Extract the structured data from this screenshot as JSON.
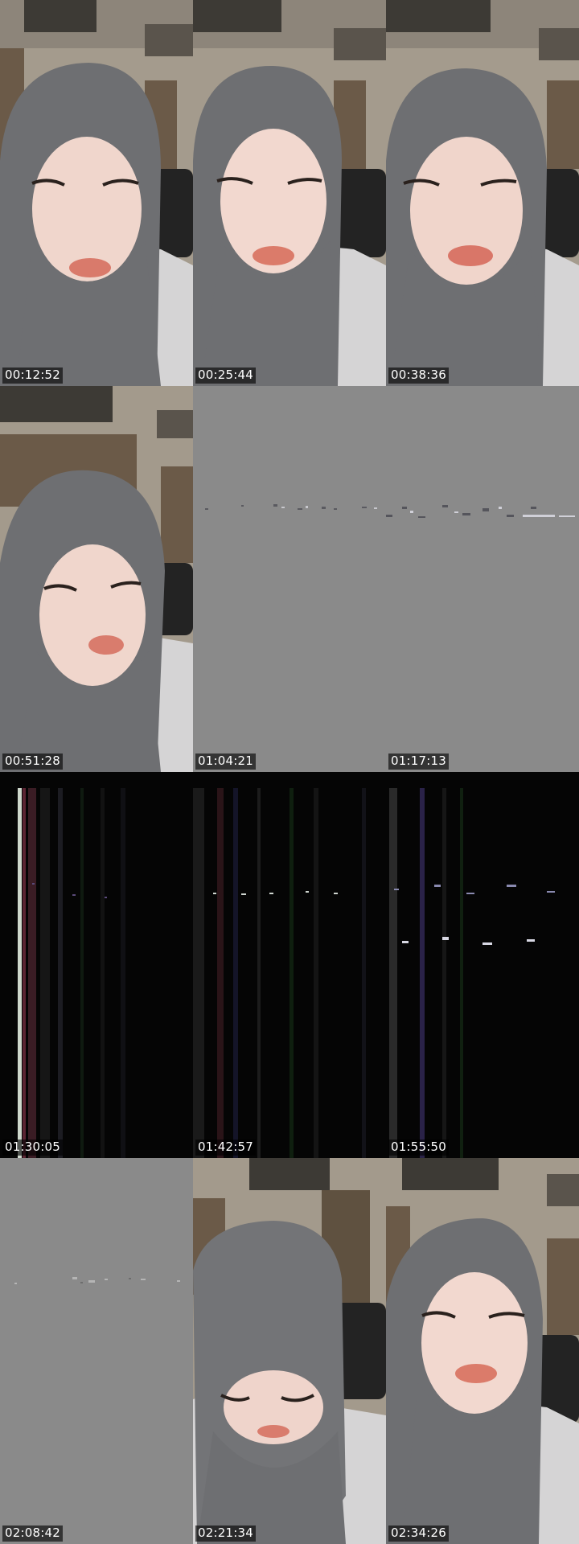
{
  "frames": [
    {
      "timestamp": "00:12:52",
      "kind": "portrait"
    },
    {
      "timestamp": "00:25:44",
      "kind": "portrait"
    },
    {
      "timestamp": "00:38:36",
      "kind": "portrait"
    },
    {
      "timestamp": "00:51:28",
      "kind": "portrait"
    },
    {
      "timestamp": "01:04:21",
      "kind": "gray-glitch"
    },
    {
      "timestamp": "01:17:13",
      "kind": "gray-glitch"
    },
    {
      "timestamp": "01:30:05",
      "kind": "dark-glitch"
    },
    {
      "timestamp": "01:42:57",
      "kind": "dark-glitch"
    },
    {
      "timestamp": "01:55:50",
      "kind": "dark-glitch"
    },
    {
      "timestamp": "02:08:42",
      "kind": "gray-glitch"
    },
    {
      "timestamp": "02:21:34",
      "kind": "portrait-looking-down"
    },
    {
      "timestamp": "02:34:26",
      "kind": "portrait"
    }
  ],
  "colors": {
    "wall": "#a39a8c",
    "hijab": "#6f7073",
    "skin": "#eed5cc",
    "gray_frame": "#8a8a8a",
    "dark_frame": "#050505"
  }
}
